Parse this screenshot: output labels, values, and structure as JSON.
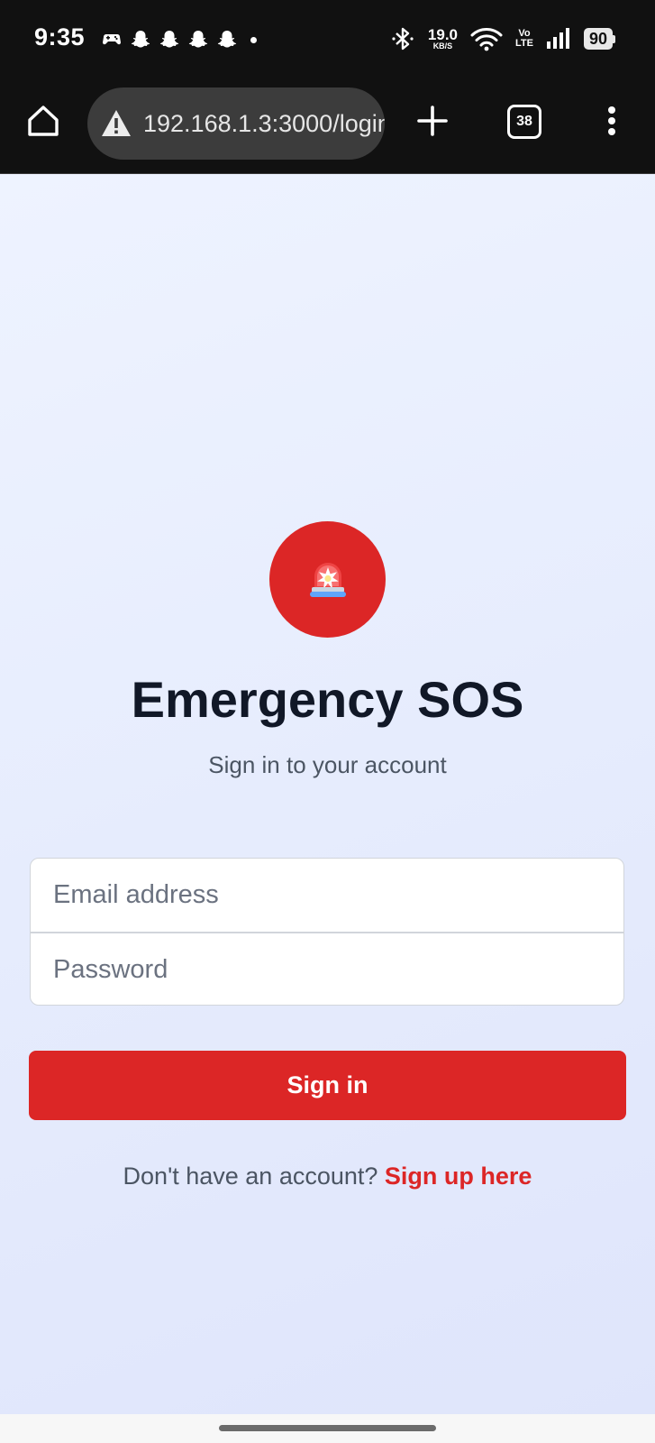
{
  "status_bar": {
    "time": "9:35",
    "notifications": [
      "game-controller-icon",
      "snapchat-icon",
      "snapchat-icon",
      "snapchat-icon",
      "snapchat-icon"
    ],
    "net_speed_value": "19.0",
    "net_speed_unit": "KB/S",
    "volte_top": "Vo",
    "volte_bottom": "LTE",
    "battery": "90"
  },
  "browser": {
    "url": "192.168.1.3:3000/login",
    "tab_count": "38"
  },
  "login": {
    "title": "Emergency SOS",
    "subtitle": "Sign in to your account",
    "email_placeholder": "Email address",
    "password_placeholder": "Password",
    "signin_label": "Sign in",
    "no_account_text": "Don't have an account? ",
    "signup_link": "Sign up here"
  },
  "colors": {
    "brand_red": "#dc2626",
    "title_text": "#111827",
    "muted_text": "#4b5563"
  }
}
